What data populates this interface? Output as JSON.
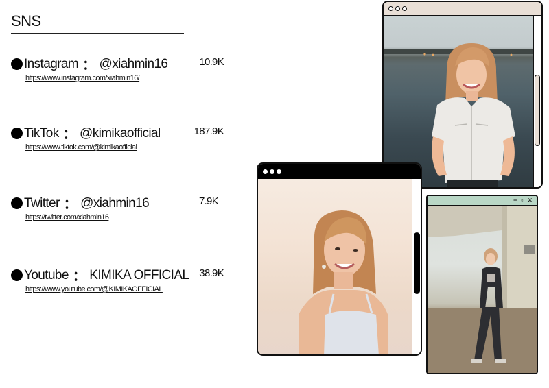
{
  "header": {
    "title": "SNS"
  },
  "accounts": [
    {
      "platform": "Instagram",
      "separator": "：",
      "handle": "@xiahmin16",
      "followers": "10.9K",
      "url": "https://www.instagram.com/xiahmin16/"
    },
    {
      "platform": "TikTok",
      "separator": "：",
      "handle": "@kimikaofficial",
      "followers": "187.9K",
      "url": "https://www.tiktok.com/@kimikaofficial"
    },
    {
      "platform": "Twitter",
      "separator": "：",
      "handle": "@xiahmin16",
      "followers": "7.9K",
      "url": "https://twitter.com/xiahmin16"
    },
    {
      "platform": "Youtube",
      "separator": "：",
      "handle": "KIMIKA OFFICIAL",
      "followers": "38.9K",
      "url": "https://www.youtube.com/@KIMIKAOFFICIAL"
    }
  ],
  "windows": {
    "top_right": {
      "bar_color": "#e9dfd6",
      "thumb_color": "#e9dfd6"
    },
    "middle": {
      "bar_color": "#000000",
      "thumb_color": "#000000"
    },
    "bottom_right": {
      "bar_color": "#b9d7c6",
      "controls": [
        "−",
        "▫",
        "✕"
      ]
    }
  }
}
